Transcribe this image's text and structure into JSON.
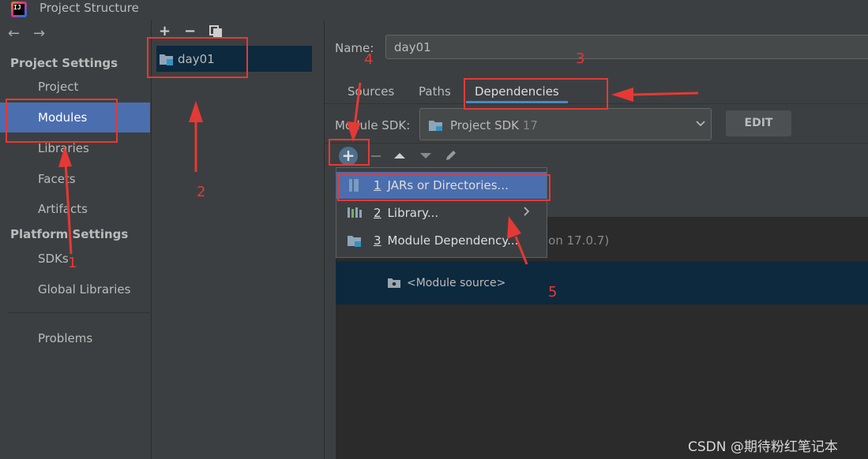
{
  "window": {
    "title": "Project Structure"
  },
  "nav": {
    "back": "←",
    "forward": "→",
    "project_settings": "Project Settings",
    "platform_settings": "Platform Settings",
    "items": {
      "project": "Project",
      "modules": "Modules",
      "libraries": "Libraries",
      "facets": "Facets",
      "artifacts": "Artifacts",
      "sdks": "SDKs",
      "global_libraries": "Global Libraries",
      "problems": "Problems"
    }
  },
  "modules": {
    "add": "+",
    "remove": "−",
    "list": [
      "day01"
    ]
  },
  "module": {
    "name_label": "Name:",
    "name_value": "day01",
    "tabs": [
      "Sources",
      "Paths",
      "Dependencies"
    ],
    "active_tab": "Dependencies",
    "sdk_label": "Module SDK:",
    "sdk_value": "Project SDK",
    "sdk_version": "17",
    "edit_button": "EDIT"
  },
  "dependencies": {
    "add": "+",
    "rows": {
      "sdk_partial": "ion 17.0.7)",
      "module_source": "<Module source>"
    }
  },
  "popup": {
    "items": [
      {
        "num": "1",
        "label": "JARs or Directories..."
      },
      {
        "num": "2",
        "label": "Library..."
      },
      {
        "num": "3",
        "label": "Module Dependency..."
      }
    ]
  },
  "annotations": {
    "n1": "1",
    "n2": "2",
    "n3": "3",
    "n4": "4",
    "n5": "5",
    "color": "#e53935"
  },
  "watermark": "CSDN @期待粉红笔记本",
  "colors": {
    "selection": "#4b6eaf",
    "row_selected": "#0d293e",
    "background": "#3c3f41",
    "tab_underline": "#4a88c7"
  }
}
